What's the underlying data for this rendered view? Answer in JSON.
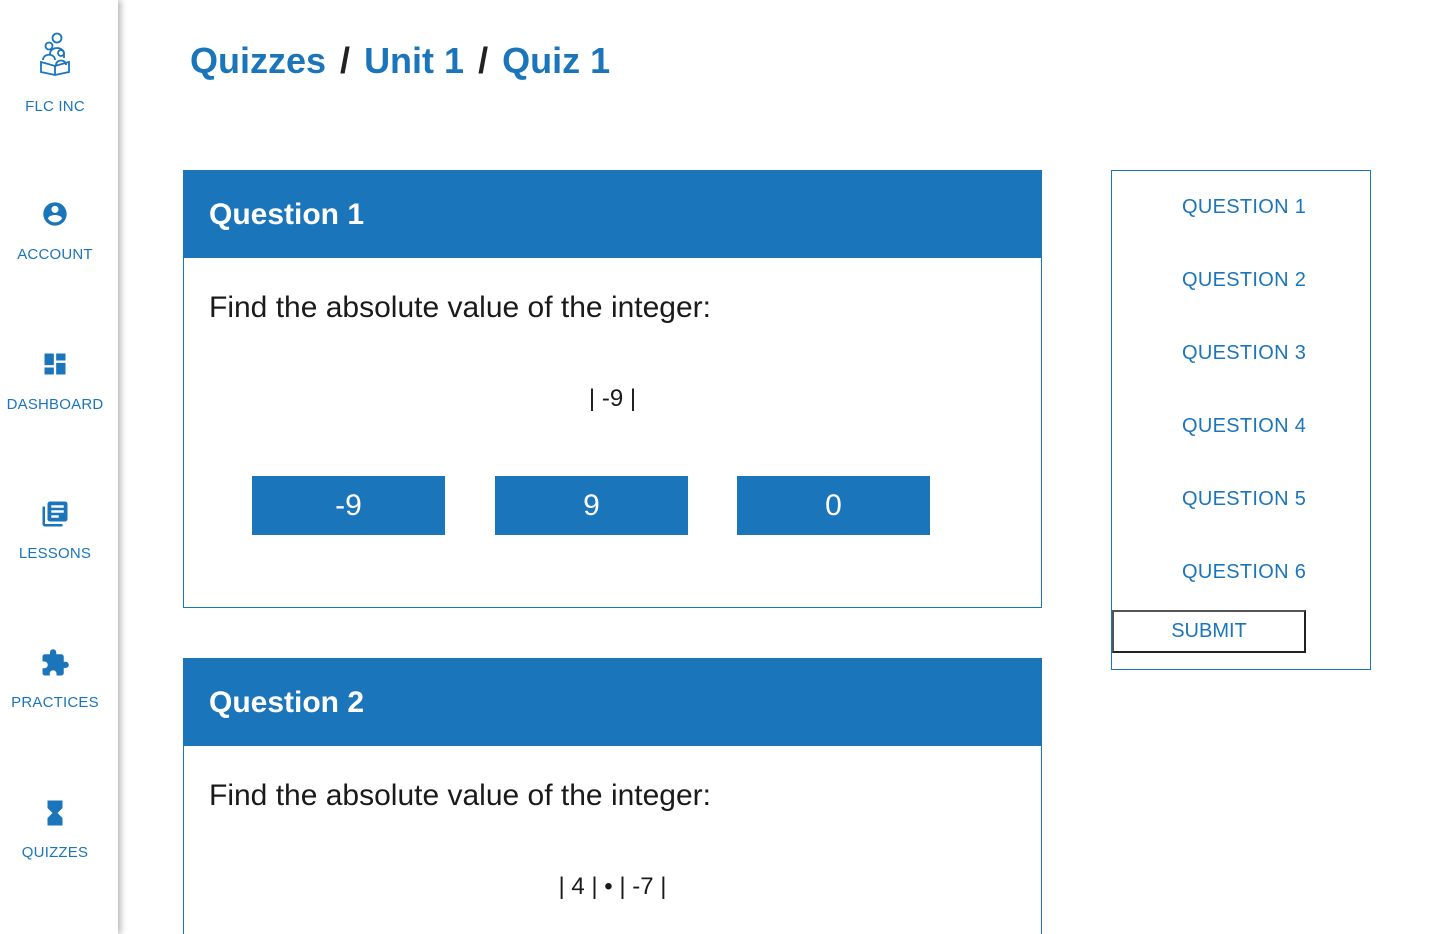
{
  "sidebar": {
    "items": [
      {
        "label": "FLC INC",
        "icon": "family-logo-icon"
      },
      {
        "label": "ACCOUNT",
        "icon": "account-circle-icon"
      },
      {
        "label": "DASHBOARD",
        "icon": "dashboard-icon"
      },
      {
        "label": "LESSONS",
        "icon": "library-books-icon"
      },
      {
        "label": "PRACTICES",
        "icon": "puzzle-piece-icon"
      },
      {
        "label": "QUIZZES",
        "icon": "hourglass-icon"
      }
    ]
  },
  "breadcrumb": {
    "items": [
      "Quizzes",
      "Unit 1",
      "Quiz 1"
    ],
    "separator": "/"
  },
  "questions": [
    {
      "title": "Question 1",
      "prompt": "Find the absolute value of the integer:",
      "expression": "| -9 |",
      "answers": [
        "-9",
        "9",
        "0"
      ]
    },
    {
      "title": "Question 2",
      "prompt": "Find the absolute value of the integer:",
      "expression": "| 4 | • | -7 |"
    }
  ],
  "question_nav": {
    "items": [
      "QUESTION 1",
      "QUESTION 2",
      "QUESTION 3",
      "QUESTION 4",
      "QUESTION 5",
      "QUESTION 6"
    ],
    "submit_label": "SUBMIT"
  },
  "colors": {
    "accent": "#1b75bb",
    "text": "#1a1a1a",
    "background": "#ffffff"
  }
}
